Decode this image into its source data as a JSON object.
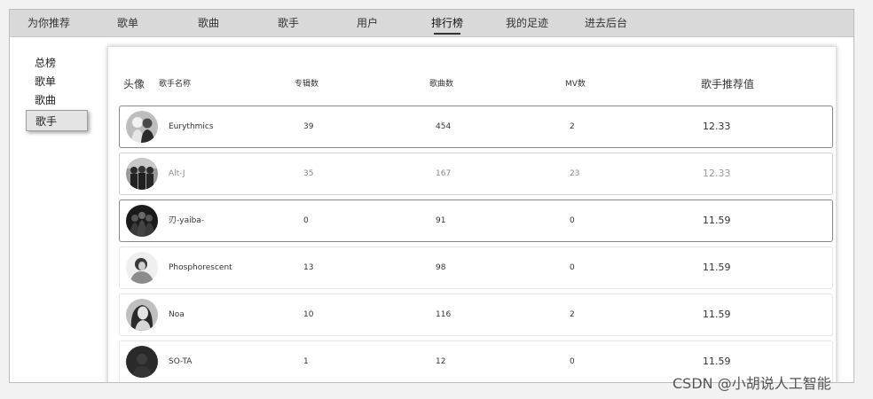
{
  "nav": {
    "items": [
      "为你推荐",
      "歌单",
      "歌曲",
      "歌手",
      "用户",
      "排行榜",
      "我的足迹",
      "进去后台"
    ],
    "active": "排行榜"
  },
  "sidebar": {
    "items": [
      "总榜",
      "歌单",
      "歌曲",
      "歌手"
    ],
    "active": "歌手"
  },
  "table": {
    "headers": {
      "avatar": "头像",
      "name": "歌手名称",
      "albums": "专辑数",
      "songs": "歌曲数",
      "mv": "MV数",
      "score": "歌手推荐值"
    },
    "rows": [
      {
        "name": "Eurythmics",
        "albums": "39",
        "songs": "454",
        "mv": "2",
        "score": "12.33",
        "avatar_icon": "duo-portrait-icon"
      },
      {
        "name": "Alt-J",
        "albums": "35",
        "songs": "167",
        "mv": "23",
        "score": "12.33",
        "avatar_icon": "band-portrait-icon"
      },
      {
        "name": "刃-yaiba-",
        "albums": "0",
        "songs": "91",
        "mv": "0",
        "score": "11.59",
        "avatar_icon": "group-portrait-icon"
      },
      {
        "name": "Phosphorescent",
        "albums": "13",
        "songs": "98",
        "mv": "0",
        "score": "11.59",
        "avatar_icon": "person-portrait-icon"
      },
      {
        "name": "Noa",
        "albums": "10",
        "songs": "116",
        "mv": "2",
        "score": "11.59",
        "avatar_icon": "woman-portrait-icon"
      },
      {
        "name": "SO-TA",
        "albums": "1",
        "songs": "12",
        "mv": "0",
        "score": "11.59",
        "avatar_icon": "dark-portrait-icon"
      }
    ]
  },
  "watermark": "CSDN @小胡说人工智能"
}
